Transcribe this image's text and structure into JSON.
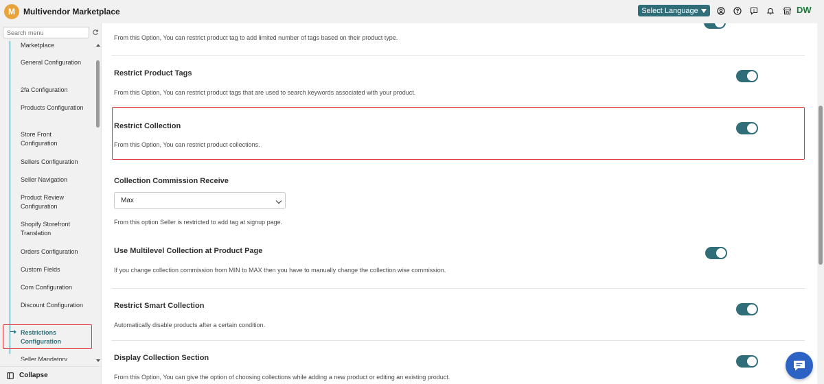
{
  "app": {
    "brand_initial": "M",
    "brand_name": "Multivendor Marketplace",
    "user_initials": "DW"
  },
  "topbar": {
    "language_button": "Select Language",
    "icons": [
      "user-circle-icon",
      "help-circle-icon",
      "message-icon",
      "bell-icon",
      "store-icon"
    ]
  },
  "sidebar": {
    "search_placeholder": "Search menu",
    "items": [
      {
        "label": "Marketplace"
      },
      {
        "label": "General Configuration"
      },
      {
        "label": "2fa Configuration"
      },
      {
        "label": "Products Configuration"
      },
      {
        "label": "Store Front Configuration"
      },
      {
        "label": "Sellers Configuration"
      },
      {
        "label": "Seller Navigation"
      },
      {
        "label": "Product Review Configuration"
      },
      {
        "label": "Shopify Storefront Translation"
      },
      {
        "label": "Orders Configuration"
      },
      {
        "label": "Custom Fields"
      },
      {
        "label": "Com Configuration"
      },
      {
        "label": "Discount Configuration"
      },
      {
        "label": "Restrictions Configuration",
        "active": true
      },
      {
        "label": "Seller Mandatory"
      }
    ],
    "collapse_label": "Collapse"
  },
  "main": {
    "top_partial_desc": "From this Option, You can restrict product tag to add limited number of tags based on their product type.",
    "sections": [
      {
        "title": "Restrict Product Tags",
        "desc": "From this Option, You can restrict product tags that are used to search keywords associated with your product.",
        "enabled": true
      },
      {
        "title": "Restrict Collection",
        "desc": "From this Option, You can restrict product collections.",
        "enabled": true
      },
      {
        "title": "Collection Commission Receive",
        "select_value": "Max",
        "desc": "From this option Seller is restricted to add tag at signup page."
      },
      {
        "title": "Use Multilevel Collection at Product Page",
        "desc": "If you change collection commission from MIN to MAX then you have to manually change the collection wise commission.",
        "enabled": true
      },
      {
        "title": "Restrict Smart Collection",
        "desc": "Automatically disable products after a certain condition.",
        "enabled": true
      },
      {
        "title": "Display Collection Section",
        "desc": "From this Option, You can give the option of choosing collections while adding a new product or editing an existing product.",
        "enabled": true
      }
    ]
  },
  "colors": {
    "accent": "#2f6d78",
    "highlight": "#e0393e",
    "chat": "#2c62c4",
    "brand_logo": "#e8a33d"
  }
}
